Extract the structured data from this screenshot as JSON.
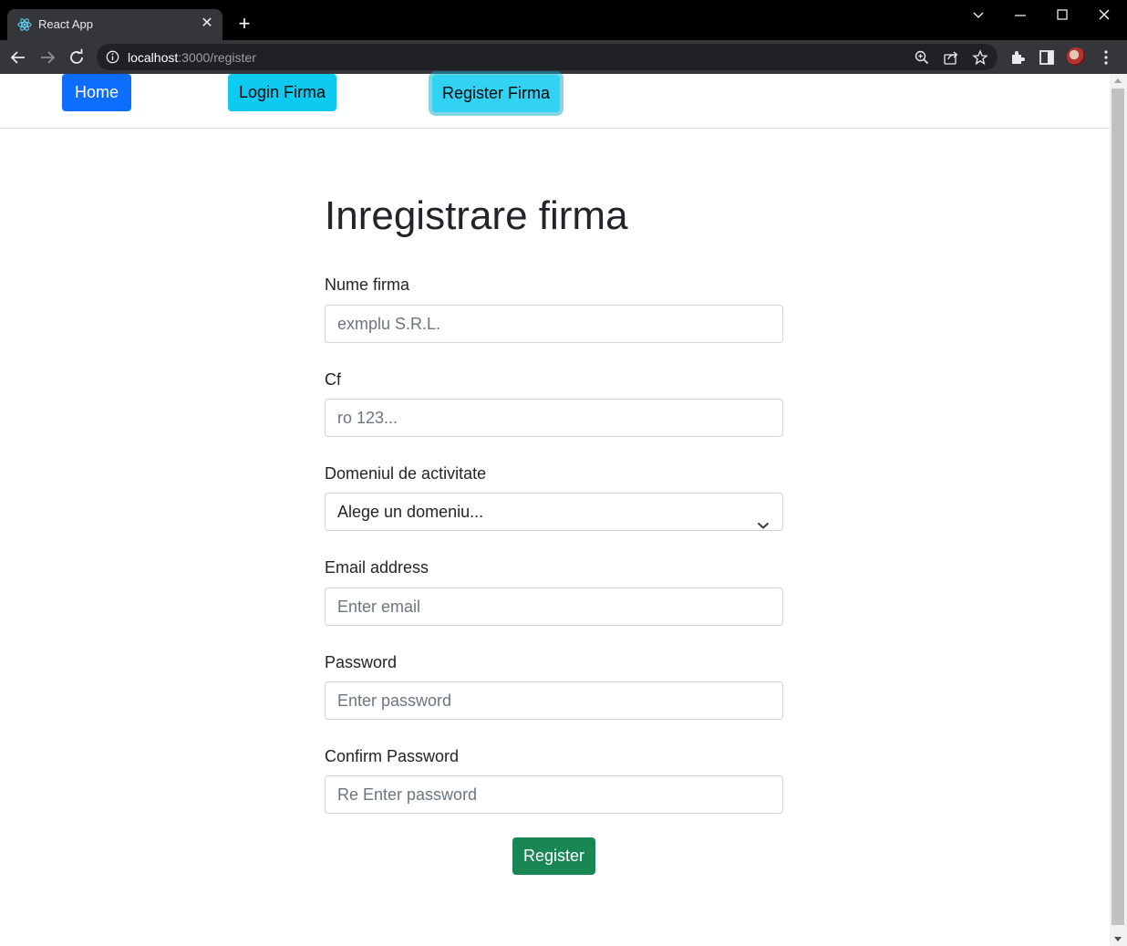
{
  "browser": {
    "tab_title": "React App",
    "url_host": "localhost",
    "url_path": ":3000/register"
  },
  "nav": {
    "home": "Home",
    "login": "Login Firma",
    "register": "Register Firma"
  },
  "form": {
    "title": "Inregistrare firma",
    "fields": [
      {
        "label": "Nume firma",
        "placeholder": " exmplu S.R.L."
      },
      {
        "label": "Cf",
        "placeholder": "ro 123..."
      },
      {
        "label": "Domeniul de activitate",
        "value": "Alege un domeniu..."
      },
      {
        "label": "Email address",
        "placeholder": "Enter email"
      },
      {
        "label": "Password",
        "placeholder": "Enter password"
      },
      {
        "label": "Confirm Password",
        "placeholder": "Re Enter password"
      }
    ],
    "submit": "Register"
  },
  "colors": {
    "primary": "#0d6efd",
    "info": "#0dcaf0",
    "success": "#198754"
  }
}
